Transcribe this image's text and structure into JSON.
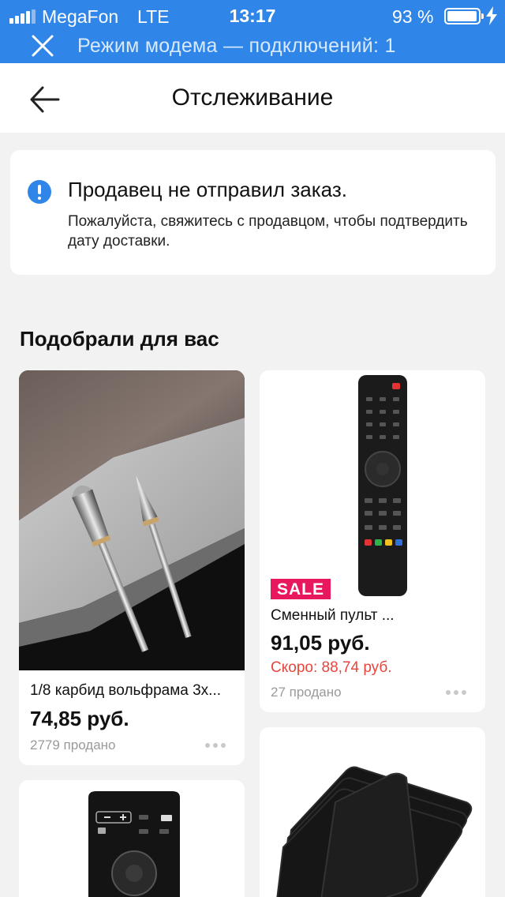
{
  "status_bar": {
    "carrier": "MegaFon",
    "network": "LTE",
    "time": "13:17",
    "battery": "93 %",
    "battery_level": 0.93,
    "hotspot_text": "Режим модема — подключений: 1",
    "background": "#2f86e8"
  },
  "header": {
    "title": "Отслеживание",
    "back_icon": "arrow-left-icon"
  },
  "notice": {
    "icon": "info-icon",
    "title": "Продавец не отправил заказ.",
    "text": "Пожалуйста, свяжитесь с продавцом, чтобы подтвердить дату доставки."
  },
  "recommendations": {
    "title": "Подобрали для вас",
    "products": [
      {
        "name": "1/8 карбид вольфрама 3x...",
        "price": "74,85 руб.",
        "sold": "2779 продано"
      },
      {
        "badge": "SALE",
        "name": "Сменный пульт ...",
        "price": "91,05 руб.",
        "soon_price": "Скоро: 88,74 руб.",
        "sold": "27 продано"
      },
      {},
      {}
    ]
  },
  "colors": {
    "accent": "#2f86e8",
    "sale": "#e8185f",
    "soon_price": "#e8453c"
  }
}
